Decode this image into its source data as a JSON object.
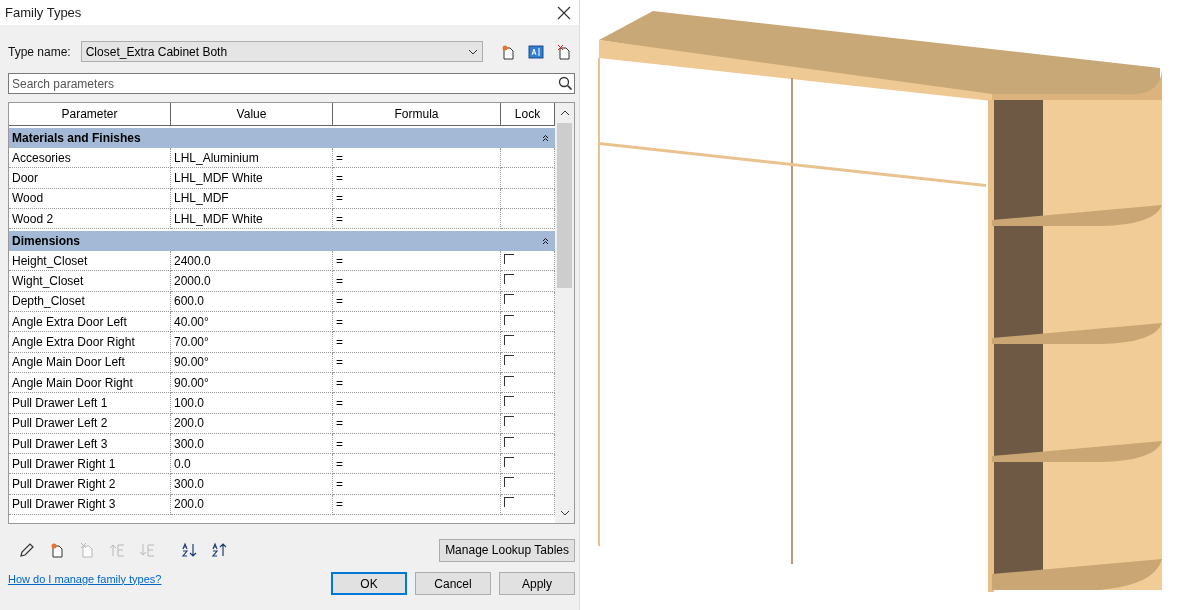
{
  "window": {
    "title": "Family Types"
  },
  "type_name": {
    "label": "Type name:",
    "value": "Closet_Extra Cabinet Both"
  },
  "search": {
    "placeholder": "Search parameters"
  },
  "table": {
    "columns": [
      "Parameter",
      "Value",
      "Formula",
      "Lock"
    ],
    "groups": [
      {
        "title": "Materials and Finishes",
        "expanded": true,
        "rows": [
          {
            "parameter": "Accesories",
            "value": "LHL_Aluminium",
            "formula": "="
          },
          {
            "parameter": "Door",
            "value": "LHL_MDF White",
            "formula": "="
          },
          {
            "parameter": "Wood",
            "value": "LHL_MDF",
            "formula": "="
          },
          {
            "parameter": "Wood 2",
            "value": "LHL_MDF White",
            "formula": "="
          }
        ]
      },
      {
        "title": "Dimensions",
        "expanded": true,
        "rows": [
          {
            "parameter": "Height_Closet",
            "value": "2400.0",
            "formula": "=",
            "locked": false
          },
          {
            "parameter": "Wight_Closet",
            "value": "2000.0",
            "formula": "=",
            "locked": false
          },
          {
            "parameter": "Depth_Closet",
            "value": "600.0",
            "formula": "=",
            "locked": false
          },
          {
            "parameter": "Angle Extra Door Left",
            "value": "40.00°",
            "formula": "=",
            "locked": false
          },
          {
            "parameter": "Angle Extra Door Right",
            "value": "70.00°",
            "formula": "=",
            "locked": false
          },
          {
            "parameter": "Angle Main Door Left",
            "value": "90.00°",
            "formula": "=",
            "locked": false
          },
          {
            "parameter": "Angle Main Door Right",
            "value": "90.00°",
            "formula": "=",
            "locked": false
          },
          {
            "parameter": "Pull Drawer Left 1",
            "value": "100.0",
            "formula": "=",
            "locked": false
          },
          {
            "parameter": "Pull Drawer Left 2",
            "value": "200.0",
            "formula": "=",
            "locked": false
          },
          {
            "parameter": "Pull Drawer Left 3",
            "value": "300.0",
            "formula": "=",
            "locked": false
          },
          {
            "parameter": "Pull Drawer Right 1",
            "value": "0.0",
            "formula": "=",
            "locked": false
          },
          {
            "parameter": "Pull Drawer Right 2",
            "value": "300.0",
            "formula": "=",
            "locked": false
          },
          {
            "parameter": "Pull Drawer Right 3",
            "value": "200.0",
            "formula": "=",
            "locked": false
          }
        ]
      }
    ]
  },
  "tools": [
    {
      "kind": "edit",
      "disabled": false
    },
    {
      "kind": "new",
      "disabled": false
    },
    {
      "kind": "delete",
      "disabled": true
    },
    {
      "kind": "up",
      "disabled": true
    },
    {
      "kind": "down",
      "disabled": true
    },
    {
      "kind": "sort-asc",
      "disabled": false
    },
    {
      "kind": "sort-desc",
      "disabled": false
    }
  ],
  "lookup_button": "Manage Lookup Tables",
  "help_link": "How do I manage family types?",
  "buttons": [
    {
      "label": "OK",
      "default": true
    },
    {
      "label": "Cancel",
      "default": false
    },
    {
      "label": "Apply",
      "default": false
    }
  ]
}
